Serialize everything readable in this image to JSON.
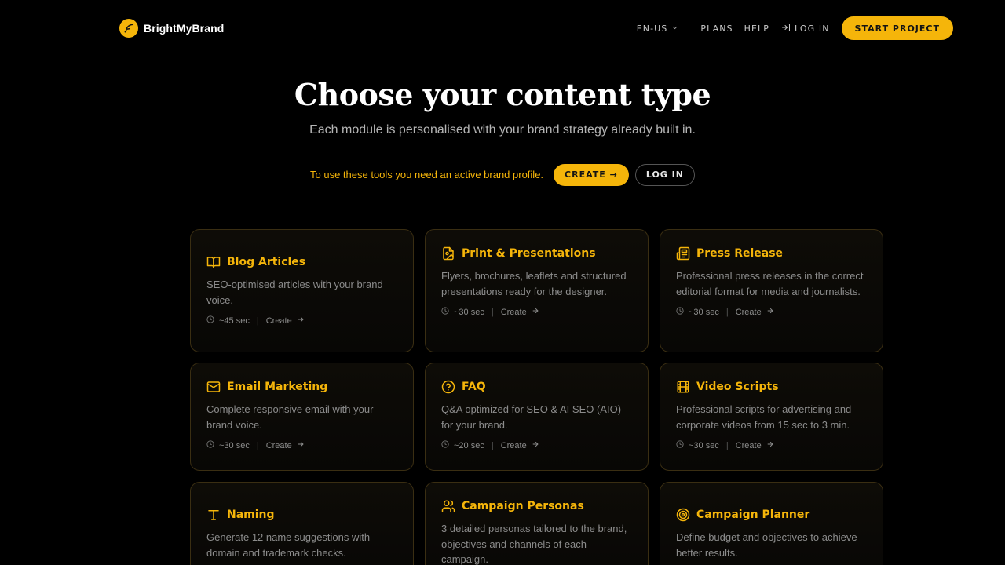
{
  "brand": {
    "name": "BrightMyBrand",
    "logo_icon": "feather-icon",
    "accent": "#f5b50a"
  },
  "nav": {
    "lang": "EN-US",
    "plans": "PLANS",
    "help": "HELP",
    "login": "LOG IN",
    "start": "START PROJECT"
  },
  "hero": {
    "title": "Choose your content type",
    "subtitle": "Each module is personalised with your brand strategy already built in."
  },
  "notice": {
    "text": "To use these tools you need an active brand profile.",
    "create": "CREATE →",
    "login": "LOG IN"
  },
  "cards": [
    {
      "title": "Blog Articles",
      "icon": "book-open-icon",
      "desc": "SEO-optimised articles with your brand voice.",
      "time": "~45 sec",
      "action": "Create"
    },
    {
      "title": "Print & Presentations",
      "icon": "file-image-icon",
      "desc": "Flyers, brochures, leaflets and structured presentations ready for the designer.",
      "time": "~30 sec",
      "action": "Create"
    },
    {
      "title": "Press Release",
      "icon": "newspaper-icon",
      "desc": "Professional press releases in the correct editorial format for media and journalists.",
      "time": "~30 sec",
      "action": "Create"
    },
    {
      "title": "Email Marketing",
      "icon": "mail-icon",
      "desc": "Complete responsive email with your brand voice.",
      "time": "~30 sec",
      "action": "Create"
    },
    {
      "title": "FAQ",
      "icon": "help-circle-icon",
      "desc": "Q&A optimized for SEO & AI SEO (AIO) for your brand.",
      "time": "~20 sec",
      "action": "Create"
    },
    {
      "title": "Video Scripts",
      "icon": "film-icon",
      "desc": "Professional scripts for advertising and corporate videos from 15 sec to 3 min.",
      "time": "~30 sec",
      "action": "Create"
    },
    {
      "title": "Naming",
      "icon": "type-icon",
      "desc": "Generate 12 name suggestions with domain and trademark checks.",
      "time": "",
      "action": ""
    },
    {
      "title": "Campaign Personas",
      "icon": "users-icon",
      "desc": "3 detailed personas tailored to the brand, objectives and channels of each campaign.",
      "time": "",
      "action": ""
    },
    {
      "title": "Campaign Planner",
      "icon": "target-icon",
      "desc": "Define budget and objectives to achieve better results.",
      "time": "",
      "action": ""
    }
  ]
}
